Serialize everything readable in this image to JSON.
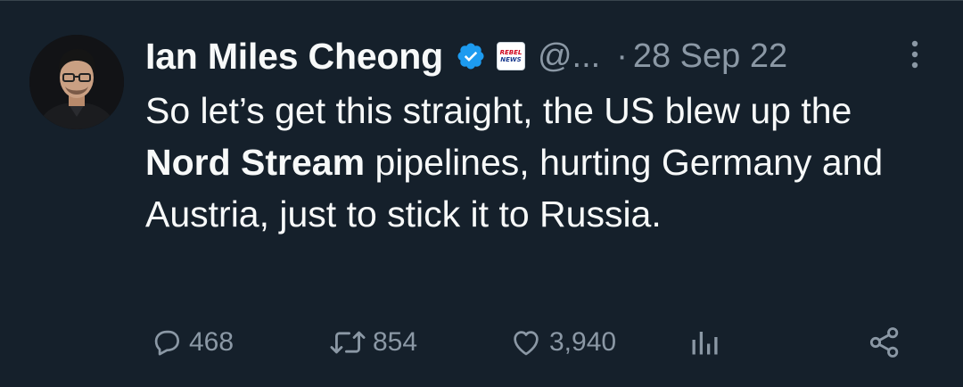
{
  "author": {
    "display_name": "Ian Miles Cheong",
    "handle": "@...",
    "affiliate_badge": {
      "line1": "REBEL",
      "line2": "NEWS"
    },
    "verified": true
  },
  "timestamp": {
    "separator": "·",
    "date": "28 Sep 22"
  },
  "body": {
    "part1": "So let’s get this straight, the US blew up the ",
    "bold": "Nord Stream",
    "part2": " pipelines, hurting Germany and Austria, just to stick it to Russia."
  },
  "actions": {
    "replies": "468",
    "retweets": "854",
    "likes": "3,940"
  },
  "colors": {
    "background": "#15202b",
    "text": "#f7f9f9",
    "muted": "#8b98a5",
    "verified_badge": "#1d9bf0"
  },
  "icons": [
    "more-icon",
    "verified-badge-icon",
    "reply-icon",
    "retweet-icon",
    "like-icon",
    "views-icon",
    "share-icon"
  ]
}
